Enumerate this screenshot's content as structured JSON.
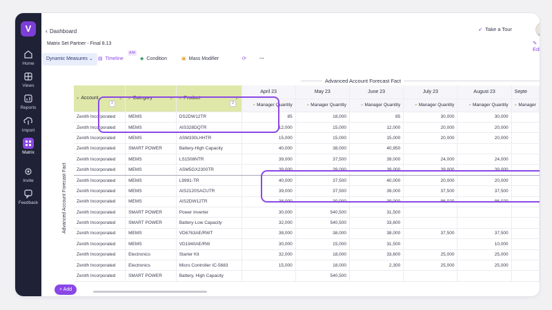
{
  "sidebar": {
    "items": [
      {
        "label": "Home",
        "icon": "home-icon"
      },
      {
        "label": "Views",
        "icon": "views-icon"
      },
      {
        "label": "Reports",
        "icon": "reports-icon"
      },
      {
        "label": "Import",
        "icon": "import-icon"
      },
      {
        "label": "Matrix",
        "icon": "matrix-icon"
      },
      {
        "label": "Invite",
        "icon": "invite-icon"
      },
      {
        "label": "Feedback",
        "icon": "feedback-icon"
      }
    ]
  },
  "header": {
    "breadcrumb": "Dashboard",
    "subtitle": "Matrix Set Partner - Final 8.13",
    "tour": "Take a Tour",
    "edit": "Edit"
  },
  "toolbar": {
    "dynamic_measures": "Dynamic Measures",
    "timeline": "Timeline",
    "timeline_badge": "A/M",
    "condition": "Condition",
    "mass_modifier": "Mass Modifier",
    "more": "···"
  },
  "grid": {
    "section_title": "Advanced Account Forecast Fact",
    "side_title": "Advanced Account Forecast Fact",
    "dims": [
      {
        "label": "Account",
        "pin": "2"
      },
      {
        "label": "Category",
        "pin": ""
      },
      {
        "label": "Product",
        "pin": "2"
      }
    ],
    "months": [
      "April 23",
      "May 23",
      "June 23",
      "July 23",
      "August 23",
      "Septe"
    ],
    "measure": "Manager Quantity",
    "measure_cut": "Manager",
    "rows": [
      [
        "Zenith Incorporated",
        "MEMS",
        "DS2DW12TR",
        "85",
        "18,000",
        "85",
        "30,000",
        "30,000"
      ],
      [
        "Zenith Incorporated",
        "MEMS",
        "AIS328DQTR",
        "12,000",
        "15,000",
        "12,000",
        "20,000",
        "20,000"
      ],
      [
        "Zenith Incorporated",
        "MEMS",
        "ASM330LHHTR",
        "15,000",
        "15,000",
        "15,000",
        "20,000",
        "20,000"
      ],
      [
        "Zenith Incorporated",
        "SMART POWER",
        "Battery-High Capacity",
        "40,000",
        "38,000",
        "40,950",
        "",
        ""
      ],
      [
        "Zenith Incorporated",
        "MEMS",
        "LS1508NTR",
        "39,000",
        "37,500",
        "39,000",
        "24,000",
        "24,000"
      ],
      [
        "Zenith Incorporated",
        "MEMS",
        "ASM5GX2300TR",
        "39,000",
        "39,000",
        "39,000",
        "39,000",
        "39,000"
      ],
      [
        "Zenith Incorporated",
        "MEMS",
        "L9991-TR",
        "40,000",
        "37,500",
        "40,000",
        "20,000",
        "20,000"
      ],
      [
        "Zenith Incorporated",
        "MEMS",
        "AIS2120SACUTR",
        "39,000",
        "37,500",
        "39,000",
        "37,500",
        "37,500"
      ],
      [
        "Zenith Incorporated",
        "MEMS",
        "AIS2DW12TR",
        "38,000",
        "30,000",
        "39,000",
        "86,020",
        "86,020"
      ],
      [
        "Zenith Incorporated",
        "SMART POWER",
        "Power Inverter",
        "30,000",
        "540,500",
        "31,500",
        "",
        ""
      ],
      [
        "Zenith Incorporated",
        "SMART POWER",
        "Battery-Low Capacity",
        "32,000",
        "540,500",
        "33,600",
        "",
        ""
      ],
      [
        "Zenith Incorporated",
        "MEMS",
        "VD6763AE/RWT",
        "38,000",
        "38,000",
        "38,000",
        "37,500",
        "37,500"
      ],
      [
        "Zenith Incorporated",
        "MEMS",
        "VD1940AE/RW",
        "30,000",
        "15,000",
        "31,500",
        "",
        "10,000"
      ],
      [
        "Zenith Incorporated",
        "Electronics",
        "Starter Kit",
        "32,000",
        "18,000",
        "33,600",
        "25,000",
        "25,000"
      ],
      [
        "Zenith Incorporated",
        "Electronics",
        "Micro Controller IC-5683",
        "15,000",
        "18,000",
        "2,300",
        "25,000",
        "25,000"
      ],
      [
        "Zenith Incorporated",
        "SMART POWER",
        "Battery, High Capacity",
        "",
        "540,500",
        "",
        "",
        ""
      ]
    ]
  },
  "footer": {
    "add": "+ Add"
  },
  "colors": {
    "accent": "#8a47e6",
    "sidebar": "#1f2137",
    "dim_header": "#dfe8a9"
  }
}
